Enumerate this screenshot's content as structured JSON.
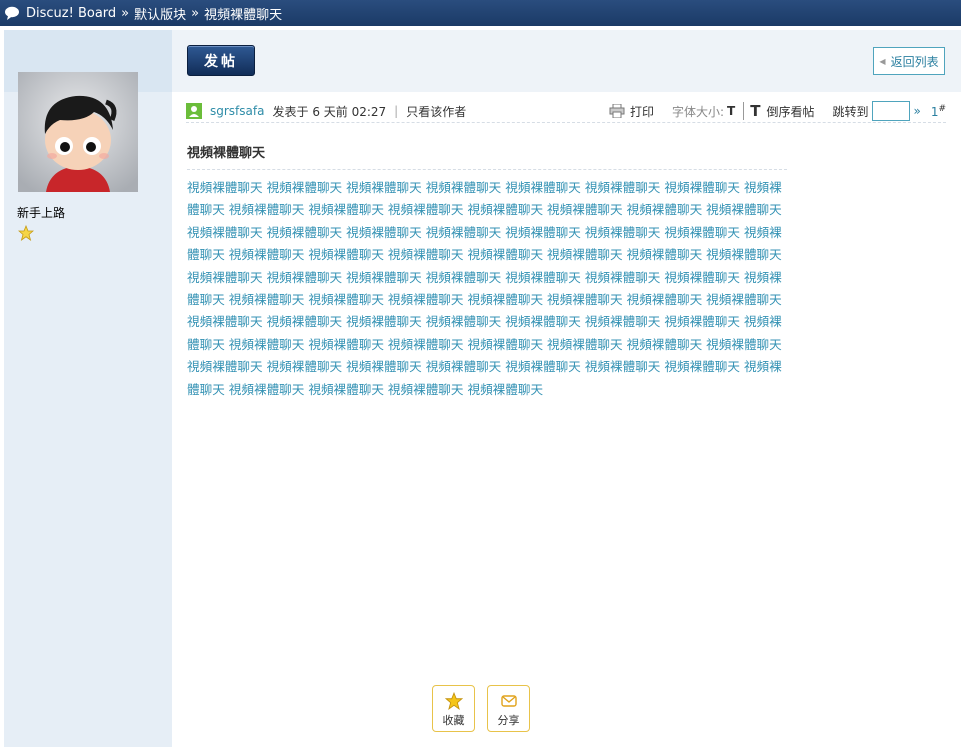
{
  "breadcrumb": {
    "site": "Discuz! Board",
    "separator": "»",
    "forum": "默认版块",
    "thread": "視頻裸體聊天"
  },
  "toolbar": {
    "post_button": "发帖",
    "back_button": "返回列表"
  },
  "author": {
    "name": "sgrsfsafa",
    "rank": "新手上路"
  },
  "post_meta": {
    "posted_prefix": "发表于",
    "posted_time": "6 天前 02:27",
    "divider": "|",
    "only_author": "只看该作者",
    "print": "打印",
    "font_size_label": "字体大小:",
    "font_size_t": "T",
    "reverse_t": "T",
    "reverse_order": "倒序看帖",
    "jump_to": "跳转到",
    "jump_go": "»",
    "floor_number": "1",
    "floor_suffix": "#"
  },
  "post": {
    "title": "視頻裸體聊天",
    "body_phrase": "視頻裸體聊天",
    "body_repeat_count": 72
  },
  "actions": {
    "favorite": "收藏",
    "share": "分享"
  },
  "colors": {
    "topbar": "#1b3a66",
    "link": "#3492b4",
    "accent_border": "#e8c34a"
  }
}
